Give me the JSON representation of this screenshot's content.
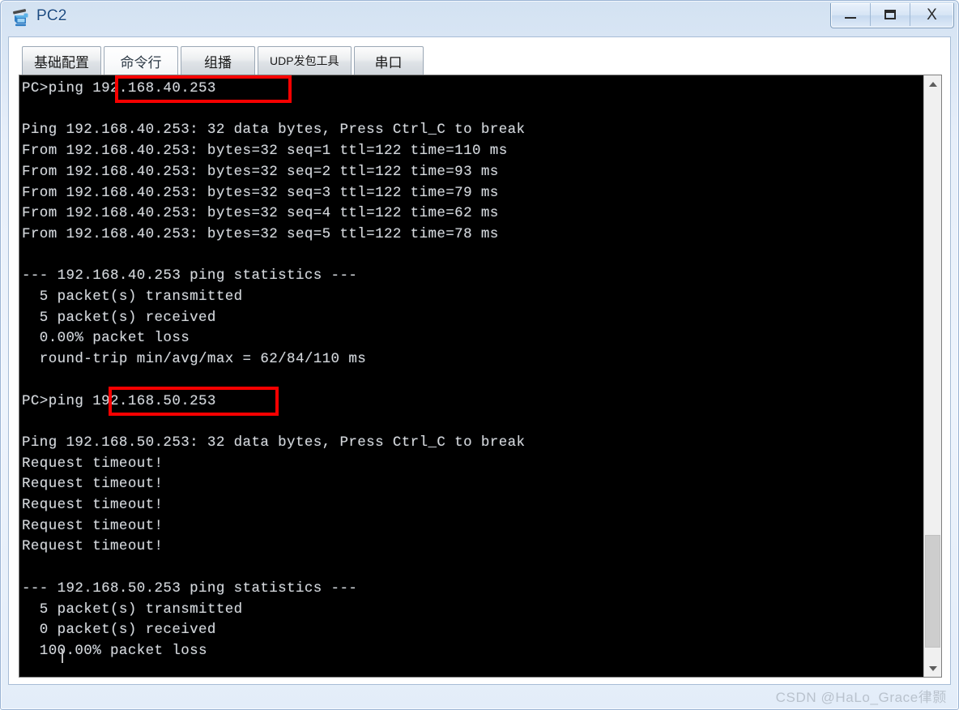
{
  "window": {
    "title": "PC2",
    "icon": "pc-host-icon",
    "controls": {
      "minimize": "–",
      "maximize": "▭",
      "close": "X"
    }
  },
  "tabs": [
    {
      "label": "基础配置",
      "name": "tab-basic-config",
      "selected": false
    },
    {
      "label": "命令行",
      "name": "tab-command-line",
      "selected": true
    },
    {
      "label": "组播",
      "name": "tab-multicast",
      "selected": false
    },
    {
      "label": "UDP发包工具",
      "name": "tab-udp-packet-tool",
      "selected": false
    },
    {
      "label": "串口",
      "name": "tab-serial-port",
      "selected": false
    }
  ],
  "terminal": {
    "lines": [
      "PC>ping 192.168.40.253",
      "",
      "Ping 192.168.40.253: 32 data bytes, Press Ctrl_C to break",
      "From 192.168.40.253: bytes=32 seq=1 ttl=122 time=110 ms",
      "From 192.168.40.253: bytes=32 seq=2 ttl=122 time=93 ms",
      "From 192.168.40.253: bytes=32 seq=3 ttl=122 time=79 ms",
      "From 192.168.40.253: bytes=32 seq=4 ttl=122 time=62 ms",
      "From 192.168.40.253: bytes=32 seq=5 ttl=122 time=78 ms",
      "",
      "--- 192.168.40.253 ping statistics ---",
      "  5 packet(s) transmitted",
      "  5 packet(s) received",
      "  0.00% packet loss",
      "  round-trip min/avg/max = 62/84/110 ms",
      "",
      "PC>ping 192.168.50.253",
      "",
      "Ping 192.168.50.253: 32 data bytes, Press Ctrl_C to break",
      "Request timeout!",
      "Request timeout!",
      "Request timeout!",
      "Request timeout!",
      "Request timeout!",
      "",
      "--- 192.168.50.253 ping statistics ---",
      "  5 packet(s) transmitted",
      "  0 packet(s) received",
      "  100.00% packet loss",
      "",
      ""
    ],
    "highlights": [
      {
        "name": "highlight-box-ip-40",
        "value": "192.168.40.253",
        "color": "#f70000"
      },
      {
        "name": "highlight-box-ip-50",
        "value": "192.168.50.253",
        "color": "#f70000"
      }
    ],
    "colors": {
      "background": "#000000",
      "text": "#d8d8d8"
    }
  },
  "scrollbar": {
    "up_arrow": "▲",
    "down_arrow": "▼"
  },
  "watermark": {
    "text": "CSDN @HaLo_Grace律颢"
  }
}
